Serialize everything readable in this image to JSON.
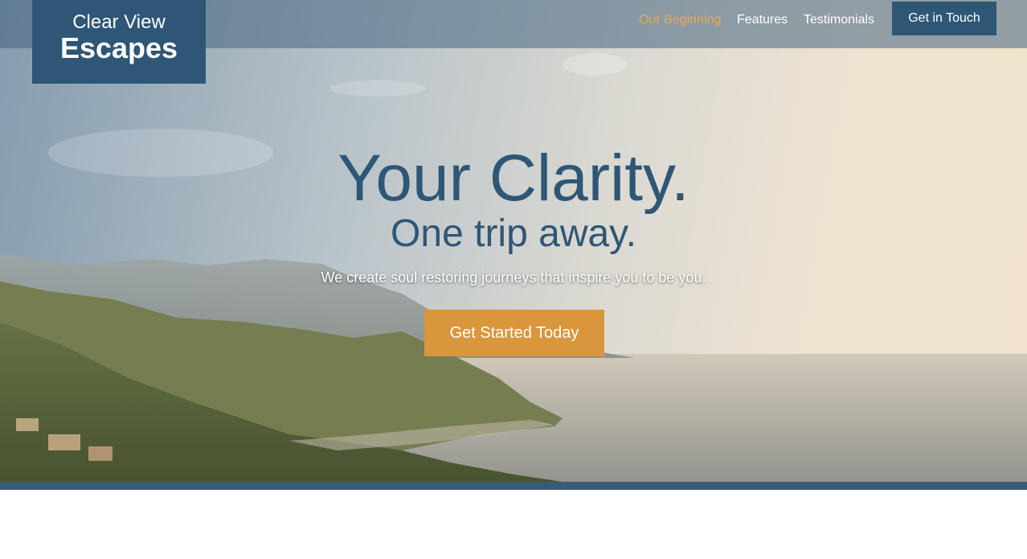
{
  "brand": {
    "line1": "Clear View",
    "line2": "Escapes"
  },
  "nav": {
    "items": [
      {
        "label": "Our Beginning",
        "active": true
      },
      {
        "label": "Features",
        "active": false
      },
      {
        "label": "Testimonials",
        "active": false
      }
    ],
    "cta_label": "Get in Touch"
  },
  "hero": {
    "headline": "Your Clarity.",
    "subheadline": "One trip away.",
    "tagline": "We create soul restoring journeys that inspire you to be you.",
    "cta_label": "Get Started Today"
  },
  "colors": {
    "brand_navy": "#2e5676",
    "accent_orange": "#d9963c",
    "active_nav": "#e9a94f",
    "strip": "#3a5b78"
  }
}
